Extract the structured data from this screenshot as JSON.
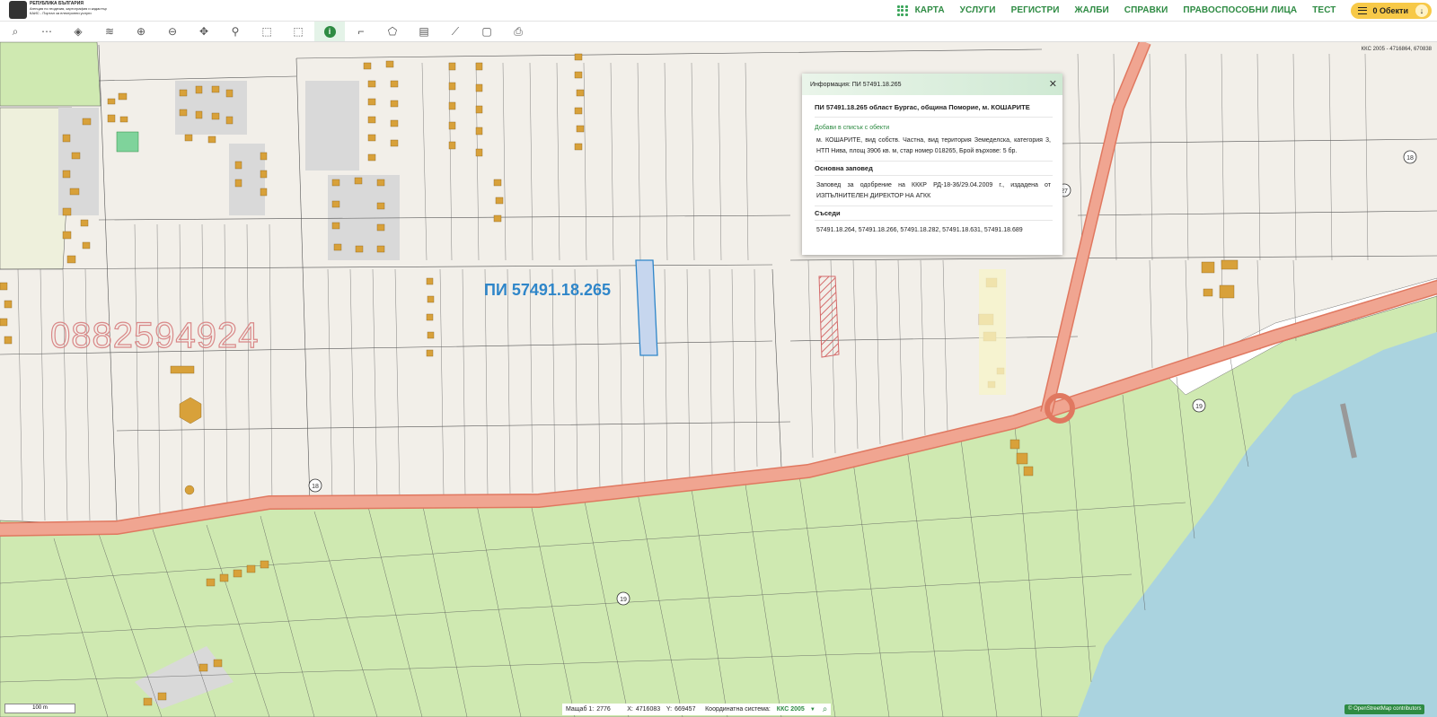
{
  "header": {
    "logo_lines": [
      "РЕПУБЛИКА БЪЛГАРИЯ",
      "Агенция по геодезия, картография и кадастър",
      "КАИС - Портал за електронни услуги"
    ],
    "nav": [
      "КАРТА",
      "УСЛУГИ",
      "РЕГИСТРИ",
      "ЖАЛБИ",
      "СПРАВКИ",
      "ПРАВОСПОСОБНИ ЛИЦА",
      "ТЕСТ"
    ],
    "objects_button": "0 Обекти",
    "icons": {
      "apps": "grid-icon",
      "objects": "list-icon",
      "download": "arrow-down-icon"
    }
  },
  "toolbar": {
    "tools": [
      {
        "name": "search",
        "glyph": "⌕"
      },
      {
        "name": "route",
        "glyph": "⋯"
      },
      {
        "name": "layers",
        "glyph": "◈"
      },
      {
        "name": "layer-stack",
        "glyph": "≋"
      },
      {
        "name": "zoom-in",
        "glyph": "⊕"
      },
      {
        "name": "zoom-out",
        "glyph": "⊖"
      },
      {
        "name": "pan",
        "glyph": "✥"
      },
      {
        "name": "location-pin",
        "glyph": "⚲"
      },
      {
        "name": "select-rect",
        "glyph": "⬚"
      },
      {
        "name": "select-poly",
        "glyph": "⬚"
      },
      {
        "name": "info",
        "glyph": "i"
      },
      {
        "name": "measure-angle",
        "glyph": "⌐"
      },
      {
        "name": "measure-area",
        "glyph": "⬠"
      },
      {
        "name": "map",
        "glyph": "▤"
      },
      {
        "name": "split",
        "glyph": "⟋"
      },
      {
        "name": "document",
        "glyph": "▢"
      },
      {
        "name": "print",
        "glyph": "⎙"
      }
    ],
    "active_tool": "info"
  },
  "map": {
    "parcel_label": "ПИ 57491.18.265",
    "watermark_phone": "0882594924",
    "corner_crs_text": "ККС 2005 - 4716864, 670838",
    "road_numbers": [
      "18",
      "18",
      "19",
      "19",
      "27"
    ],
    "colors": {
      "background": "#f2efe9",
      "agri": "#cfe9b1",
      "sea": "#aad3df",
      "road": "#f0a591",
      "road_edge": "#e07860",
      "building": "#d8a13a",
      "selected": "#c6d6ee",
      "selected_edge": "#2f86c9",
      "hatch": "#d46a6a"
    }
  },
  "info_popup": {
    "header": "Информация: ПИ 57491.18.265",
    "title": "ПИ 57491.18.265 област Бургас, община Поморие, м. КОШАРИТЕ",
    "add_link": "Добави в списък с обекти",
    "description": "м. КОШАРИТЕ, вид собств. Частна, вид територия Земеделска, категория 3, НТП Нива, площ 3906 кв. м, стар номер 018265, Брой върхове: 5 бр.",
    "order_heading": "Основна заповед",
    "order_text": "Заповед за одобрение на КККР РД-18-36/29.04.2009 г., издадена от ИЗПЪЛНИТЕЛЕН ДИРЕКТОР НА АГКК",
    "neighbors_heading": "Съседи",
    "neighbors_text": "57491.18.264, 57491.18.266, 57491.18.282, 57491.18.631, 57491.18.689"
  },
  "footer": {
    "scale_text": "100 m",
    "scale_label": "Мащаб 1:",
    "scale_value": "2776",
    "x_label": "X:",
    "x_value": "4716083",
    "y_label": "Y:",
    "y_value": "669457",
    "crs_label": "Координатна система:",
    "crs_value": "ККС 2005",
    "osm_credit": "© OpenStreetMap contributors"
  }
}
